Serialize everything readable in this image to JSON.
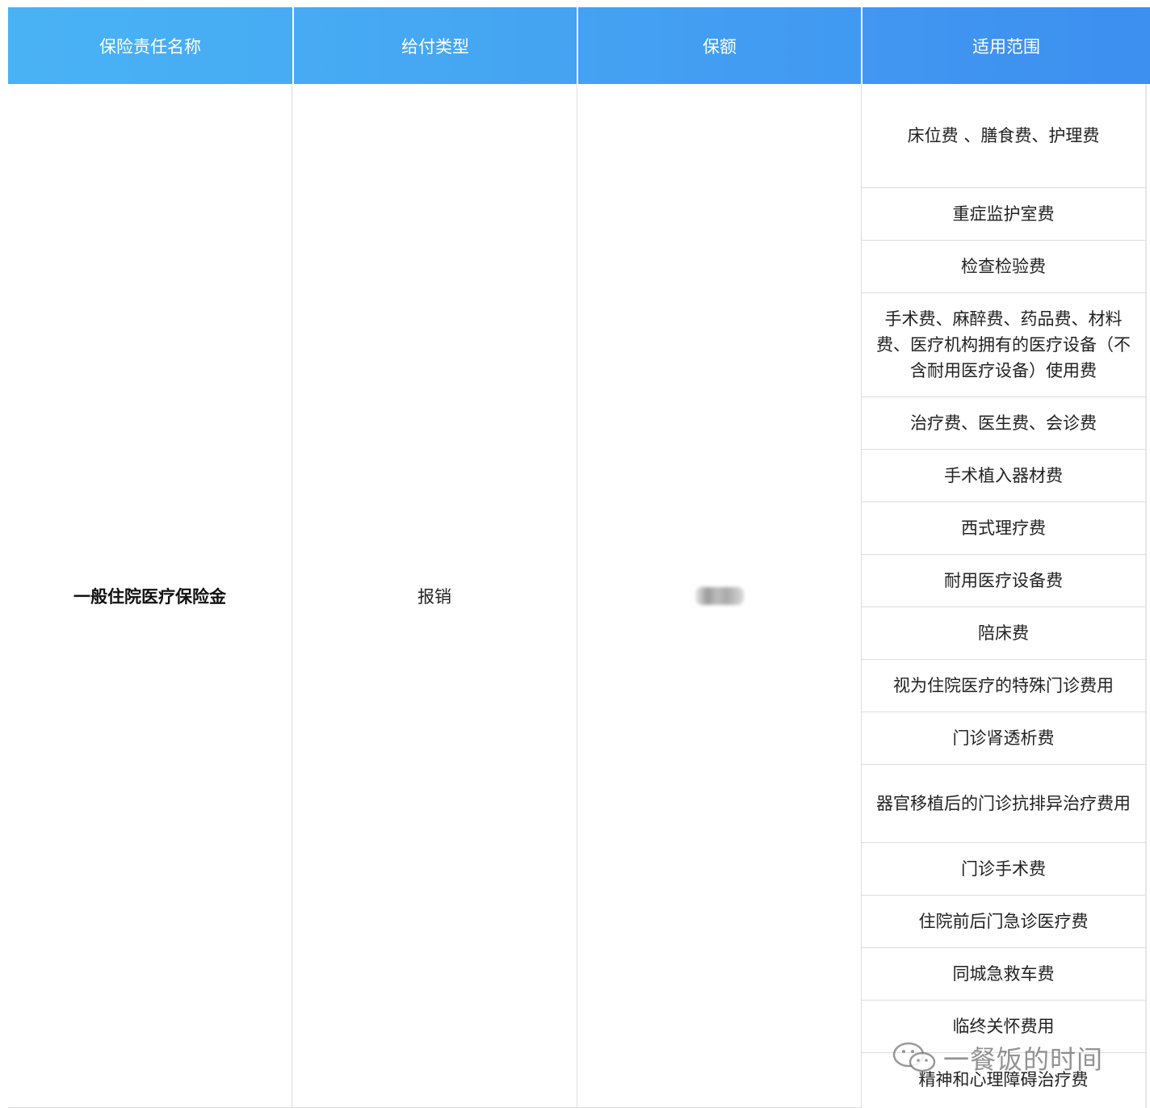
{
  "header": [
    "保险责任名称",
    "给付类型",
    "保额",
    "适用范围"
  ],
  "row": {
    "name": "一般住院医疗保险金",
    "pay_type": "报销"
  },
  "scope": [
    "床位费 、膳食费、护理费",
    "重症监护室费",
    "检查检验费",
    "手术费、麻醉费、药品费、材料费、医疗机构拥有的医疗设备（不含耐用医疗设备）使用费",
    "治疗费、医生费、会诊费",
    "手术植入器材费",
    "西式理疗费",
    "耐用医疗设备费",
    "陪床费",
    "视为住院医疗的特殊门诊费用",
    "门诊肾透析费",
    "器官移植后的门诊抗排异治疗费用",
    "门诊手术费",
    "住院前后门急诊医疗费",
    "同城急救车费",
    "临终关怀费用",
    "精神和心理障碍治疗费"
  ],
  "watermark": "一餐饭的时间",
  "colors": {
    "header_start": "#49b2f4",
    "header_end": "#3d8ff0",
    "border": "#dcdcdc"
  }
}
